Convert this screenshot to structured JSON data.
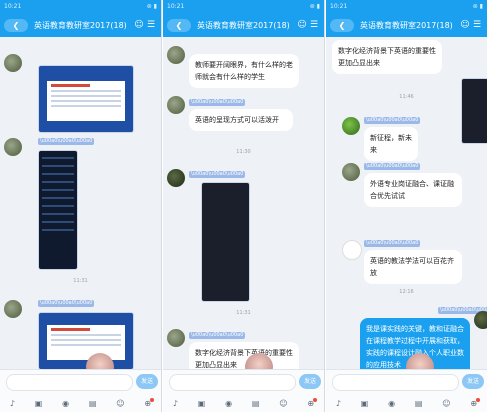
{
  "panels": [
    {
      "status": {
        "time": "10:21",
        "carrier": "░░░",
        "signal": "⊚ ▮"
      },
      "header": {
        "back": "❮",
        "title": "英语教育教研室2017(18)",
        "person": "☺",
        "menu": "☰"
      },
      "times": [
        "11:31"
      ],
      "input": {
        "placeholder": "",
        "send": "发送"
      }
    },
    {
      "status": {
        "time": "10:21",
        "carrier": "░░░",
        "signal": "⊚ ▮"
      },
      "header": {
        "back": "❮",
        "title": "英语教育教研室2017(18)",
        "person": "☺",
        "menu": "☰"
      },
      "bubbles": [
        "教师要开阔眼界，有什么样的老师就会有什么样的学生",
        "英语的呈现方式可以活泼开",
        "数字化经济背景下英语的重要性更加凸显出来"
      ],
      "times": [
        "11:30",
        "11:31"
      ],
      "input": {
        "placeholder": "",
        "send": "发送"
      }
    },
    {
      "status": {
        "time": "10:21",
        "carrier": "░░░",
        "signal": "⊚ ▮"
      },
      "header": {
        "back": "❮",
        "title": "英语教育教研室2017(18)",
        "person": "☺",
        "menu": "☰"
      },
      "bubbles": [
        "数字化经济背景下英语的重要性更加凸显出来",
        "新征程，新未来",
        "外语专业岗证融合、课证融合优先试试",
        "英语的教法学法可以百花齐放",
        "我是课实践的关键，教和证融合在课程教学过程中开展和获取，实践的课程设计融入个人职业数的应用技术"
      ],
      "times": [
        "11:46",
        "12:16"
      ],
      "input": {
        "placeholder": "",
        "send": "发送"
      }
    }
  ],
  "toolbar_icons": [
    "♪",
    "▣",
    "◉",
    "▤",
    "☺",
    "⊕"
  ],
  "accent": "#1aa0ef"
}
